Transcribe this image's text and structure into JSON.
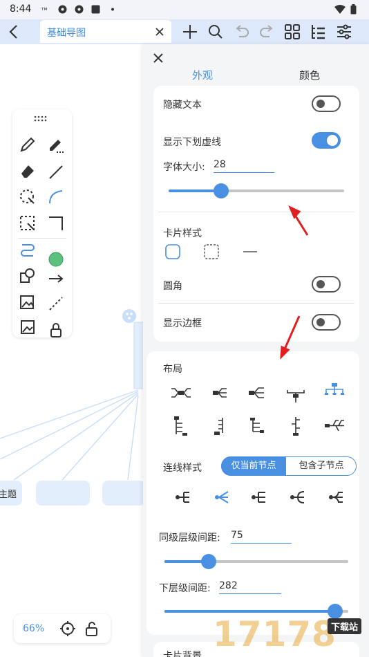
{
  "status": {
    "time": "8:44"
  },
  "header": {
    "tab_title": "基础导图"
  },
  "canvas": {
    "node_label": "主题",
    "zoom": "66%"
  },
  "panel": {
    "tabs": [
      "外观",
      "颜色"
    ],
    "appearance": {
      "hide_text_label": "隐藏文本",
      "hide_text_on": false,
      "underline_label": "显示下划虚线",
      "underline_on": true,
      "font_size_label": "字体大小:",
      "font_size_value": "28",
      "font_size_fraction": 0.3,
      "card_style_label": "卡片样式",
      "rounded_label": "圆角",
      "rounded_on": false,
      "border_label": "显示边框",
      "border_on": false
    },
    "layout": {
      "title": "布局",
      "line_style_label": "连线样式",
      "line_style_options": [
        "仅当前节点",
        "包含子节点"
      ],
      "line_style_selected": 0,
      "sibling_gap_label": "同级层级间距:",
      "sibling_gap_value": "75",
      "sibling_gap_fraction": 0.24,
      "child_gap_label": "下层级间距:",
      "child_gap_value": "282",
      "child_gap_fraction": 0.93,
      "next_section_label": "卡片背景"
    }
  },
  "watermark": {
    "text": "17178",
    "badge": "下载站"
  },
  "colors": {
    "accent": "#4a90e2",
    "header_bg": "#dde9fb",
    "annotation": "#e02020"
  }
}
